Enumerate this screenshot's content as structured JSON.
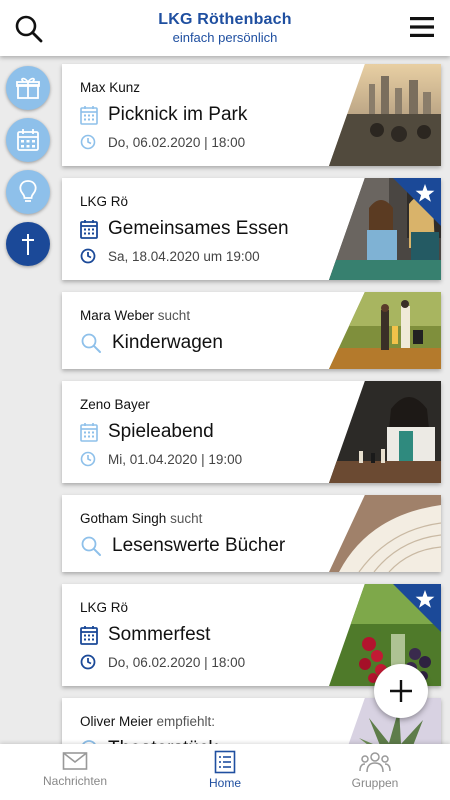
{
  "header": {
    "title": "LKG Röthenbach",
    "subtitle": "einfach persönlich"
  },
  "sidebar": {
    "categories": [
      {
        "icon": "gift-icon"
      },
      {
        "icon": "calendar-icon"
      },
      {
        "icon": "lightbulb-icon"
      },
      {
        "icon": "cross-icon"
      }
    ]
  },
  "feed": [
    {
      "author": "Max Kunz",
      "type": "event",
      "title": "Picknick im Park",
      "date": "Do, 06.02.2020 | 18:00",
      "featured": false
    },
    {
      "author": "LKG Rö",
      "type": "event",
      "title": "Gemeinsames Essen",
      "date": "Sa, 18.04.2020 um 19:00",
      "featured": true
    },
    {
      "author": "Mara Weber",
      "verb": "sucht",
      "type": "search",
      "title": "Kinderwagen"
    },
    {
      "author": "Zeno Bayer",
      "type": "event",
      "title": "Spieleabend",
      "date": "Mi, 01.04.2020 | 19:00",
      "featured": false
    },
    {
      "author": "Gotham Singh",
      "verb": "sucht",
      "type": "search",
      "title": "Lesenswerte Bücher"
    },
    {
      "author": "LKG Rö",
      "type": "event",
      "title": "Sommerfest",
      "date": "Do, 06.02.2020 | 18:00",
      "featured": true
    },
    {
      "author": "Oliver Meier",
      "verb": "empfiehlt:",
      "type": "recommend",
      "title": "Theaterstück"
    }
  ],
  "bottom_nav": [
    {
      "label": "Nachrichten",
      "icon": "mail-icon",
      "active": false
    },
    {
      "label": "Home",
      "icon": "list-icon",
      "active": true
    },
    {
      "label": "Gruppen",
      "icon": "group-icon",
      "active": false
    }
  ],
  "colors": {
    "brand": "#1f4fa0",
    "accent_light": "#8ec0ea",
    "accent_dark": "#1b4998",
    "background": "#ebebeb"
  }
}
